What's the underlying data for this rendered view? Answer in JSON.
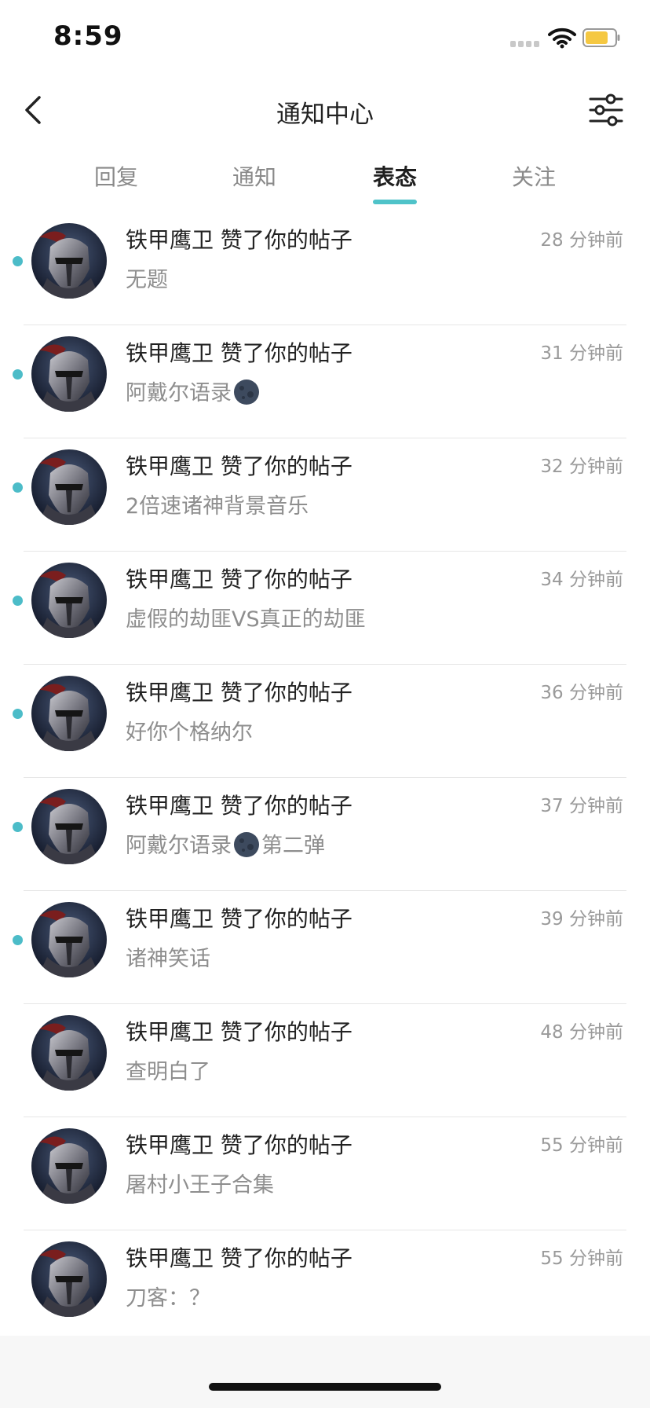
{
  "status_bar": {
    "time": "8:59"
  },
  "header": {
    "title": "通知中心"
  },
  "tabs": [
    {
      "label": "回复"
    },
    {
      "label": "通知"
    },
    {
      "label": "表态"
    },
    {
      "label": "关注"
    }
  ],
  "active_tab": "表态",
  "colors": {
    "accent": "#4fc3c9",
    "unread_dot": "#4cbcc8",
    "battery": "#f5c842"
  },
  "notifications": [
    {
      "title": "铁甲鹰卫 赞了你的帖子",
      "time": "28 分钟前",
      "text": "无题",
      "text_after_emoji": "",
      "has_emoji": false,
      "unread": true
    },
    {
      "title": "铁甲鹰卫 赞了你的帖子",
      "time": "31 分钟前",
      "text": "阿戴尔语录",
      "text_after_emoji": "",
      "has_emoji": true,
      "unread": true
    },
    {
      "title": "铁甲鹰卫 赞了你的帖子",
      "time": "32 分钟前",
      "text": "2倍速诸神背景音乐",
      "text_after_emoji": "",
      "has_emoji": false,
      "unread": true
    },
    {
      "title": "铁甲鹰卫 赞了你的帖子",
      "time": "34 分钟前",
      "text": "虚假的劫匪VS真正的劫匪",
      "text_after_emoji": "",
      "has_emoji": false,
      "unread": true
    },
    {
      "title": "铁甲鹰卫 赞了你的帖子",
      "time": "36 分钟前",
      "text": "好你个格纳尔",
      "text_after_emoji": "",
      "has_emoji": false,
      "unread": true
    },
    {
      "title": "铁甲鹰卫 赞了你的帖子",
      "time": "37 分钟前",
      "text": "阿戴尔语录",
      "text_after_emoji": "第二弹",
      "has_emoji": true,
      "unread": true
    },
    {
      "title": "铁甲鹰卫 赞了你的帖子",
      "time": "39 分钟前",
      "text": "诸神笑话",
      "text_after_emoji": "",
      "has_emoji": false,
      "unread": true
    },
    {
      "title": "铁甲鹰卫 赞了你的帖子",
      "time": "48 分钟前",
      "text": "查明白了",
      "text_after_emoji": "",
      "has_emoji": false,
      "unread": false
    },
    {
      "title": "铁甲鹰卫 赞了你的帖子",
      "time": "55 分钟前",
      "text": "屠村小王子合集",
      "text_after_emoji": "",
      "has_emoji": false,
      "unread": false
    },
    {
      "title": "铁甲鹰卫 赞了你的帖子",
      "time": "55 分钟前",
      "text": "刀客：？",
      "text_after_emoji": "",
      "has_emoji": false,
      "unread": false
    }
  ]
}
